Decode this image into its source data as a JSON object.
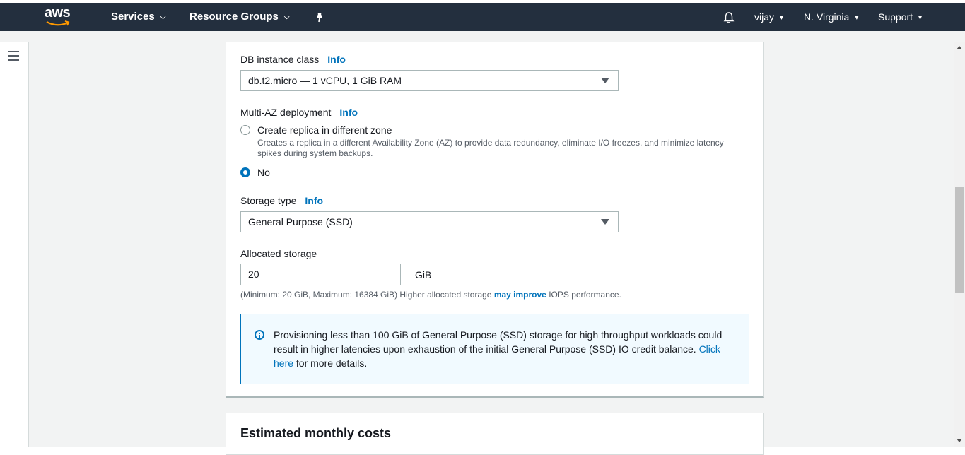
{
  "nav": {
    "logo": "aws",
    "services": "Services",
    "resource_groups": "Resource Groups",
    "user": "vijay",
    "region": "N. Virginia",
    "support": "Support"
  },
  "form": {
    "instance_class_label": "DB instance class",
    "info": "Info",
    "instance_class_value": "db.t2.micro — 1 vCPU, 1 GiB RAM",
    "multi_az_label": "Multi-AZ deployment",
    "replica_option": "Create replica in different zone",
    "replica_desc": "Creates a replica in a different Availability Zone (AZ) to provide data redundancy, eliminate I/O freezes, and minimize latency spikes during system backups.",
    "no_option": "No",
    "storage_type_label": "Storage type",
    "storage_type_value": "General Purpose (SSD)",
    "allocated_label": "Allocated storage",
    "allocated_value": "20",
    "unit": "GiB",
    "hint_before": "(Minimum: 20 GiB, Maximum: 16384 GiB) Higher allocated storage ",
    "hint_link": "may improve",
    "hint_after": " IOPS performance.",
    "alert_text": "Provisioning less than 100 GiB of General Purpose (SSD) storage for high throughput workloads could result in higher latencies upon exhaustion of the initial General Purpose (SSD) IO credit balance. ",
    "alert_link": "Click here",
    "alert_after": " for more details."
  },
  "costs_heading": "Estimated monthly costs",
  "colors": {
    "nav_bg": "#232f3e",
    "link": "#0073bb",
    "page_bg": "#f2f3f3"
  }
}
